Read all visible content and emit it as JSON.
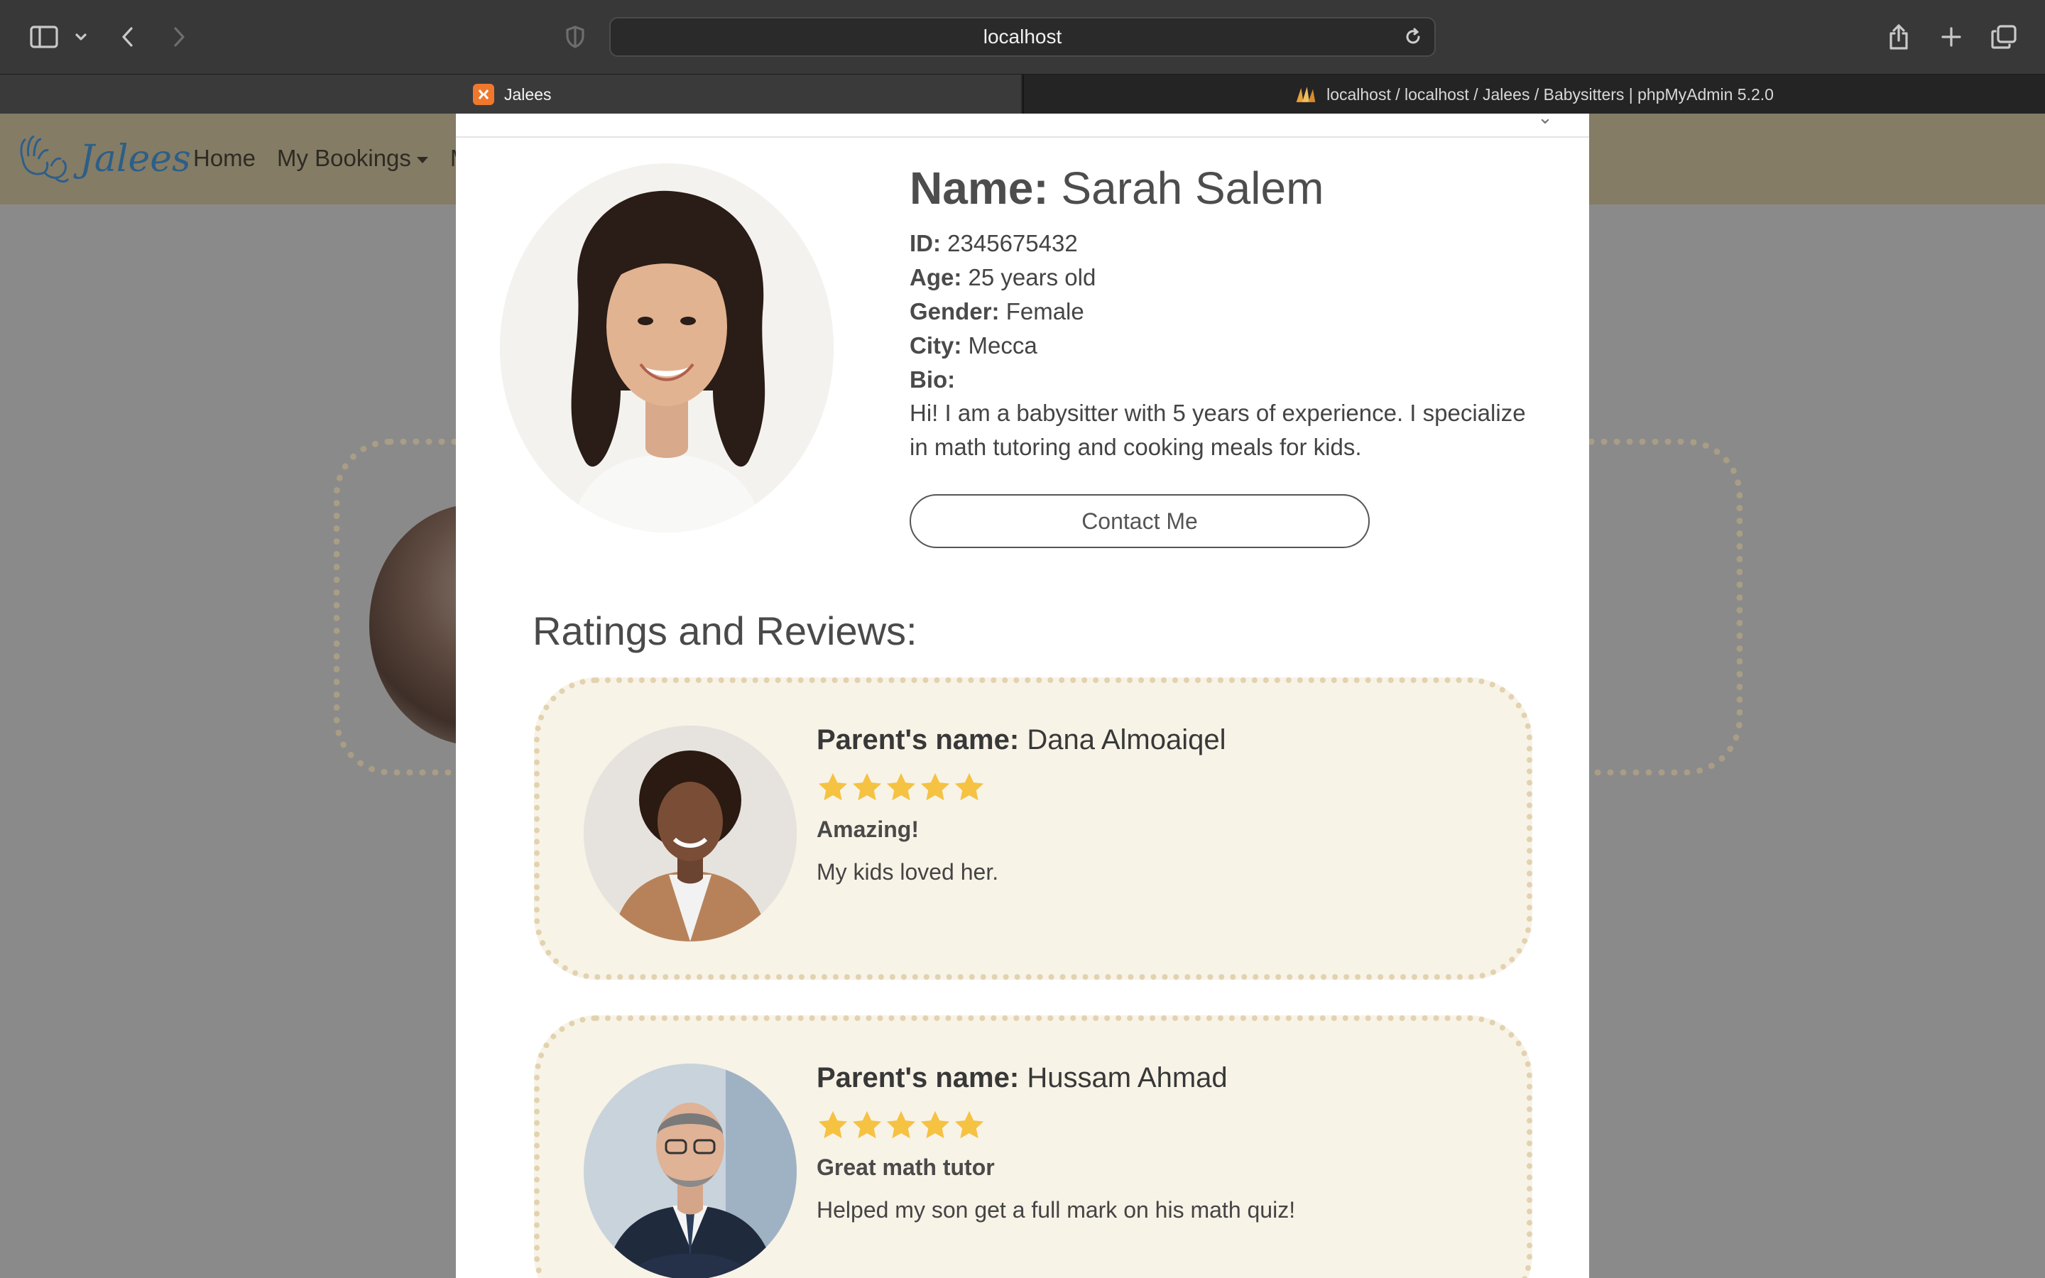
{
  "browser": {
    "url": "localhost",
    "tabs": [
      {
        "title": "Jalees",
        "favicon": "xampp-icon",
        "active": true
      },
      {
        "title": "localhost / localhost / Jalees / Babysitters | phpMyAdmin 5.2.0",
        "favicon": "phpmyadmin-icon",
        "active": false
      }
    ]
  },
  "site_nav": {
    "logo_text": "Jalees",
    "links": {
      "home": "Home",
      "bookings": "My Bookings",
      "partial": "M"
    }
  },
  "profile": {
    "name_label": "Name:",
    "name": "Sarah Salem",
    "id_label": "ID:",
    "id": "2345675432",
    "age_label": "Age:",
    "age": "25 years old",
    "gender_label": "Gender:",
    "gender": "Female",
    "city_label": "City:",
    "city": "Mecca",
    "bio_label": "Bio:",
    "bio": "Hi! I am a babysitter with 5 years of experience. I specialize in math tutoring and cooking meals for kids.",
    "contact_label": "Contact Me"
  },
  "reviews": {
    "heading": "Ratings and Reviews:",
    "parent_label": "Parent's name:",
    "items": [
      {
        "parent": "Dana Almoaiqel",
        "rating": 5,
        "title": "Amazing!",
        "body": "My kids loved her."
      },
      {
        "parent": "Hussam Ahmad",
        "rating": 5,
        "title": "Great math tutor",
        "body": "Helped my son get a full mark on his math quiz!"
      }
    ]
  },
  "colors": {
    "star": "#f5c242",
    "card_bg": "#f8f3e7",
    "card_border": "#e2d2b0",
    "logo": "#2c5f88"
  }
}
